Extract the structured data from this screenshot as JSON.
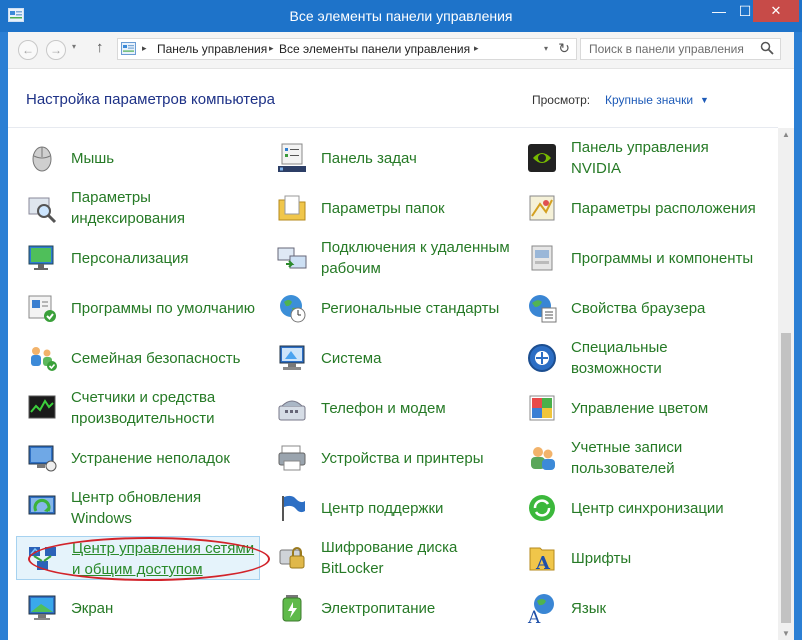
{
  "window": {
    "title": "Все элементы панели управления",
    "min_label": "—",
    "max_label": "☐",
    "close_label": "✕"
  },
  "nav": {
    "back": "←",
    "forward": "→",
    "recent": "▾",
    "up": "↑",
    "breadcrumb": [
      "Панель управления",
      "Все элементы панели управления"
    ],
    "separator": "▸",
    "address_dropdown": "▾",
    "refresh": "↻",
    "search_placeholder": "Поиск в панели управления"
  },
  "header": {
    "title": "Настройка параметров компьютера",
    "view_label": "Просмотр:",
    "view_value": "Крупные значки",
    "view_arrow": "▼"
  },
  "items": [
    {
      "label": "Мышь",
      "icon": "mouse-icon"
    },
    {
      "label": "Панель задач",
      "icon": "taskbar-icon"
    },
    {
      "label": "Панель управления NVIDIA",
      "icon": "nvidia-icon"
    },
    {
      "label": "Параметры индексирования",
      "icon": "indexing-icon"
    },
    {
      "label": "Параметры папок",
      "icon": "folder-options-icon"
    },
    {
      "label": "Параметры расположения",
      "icon": "location-icon"
    },
    {
      "label": "Персонализация",
      "icon": "personalization-icon"
    },
    {
      "label": "Подключения к удаленным рабочим",
      "icon": "remote-desktop-icon"
    },
    {
      "label": "Программы и компоненты",
      "icon": "programs-icon"
    },
    {
      "label": "Программы по умолчанию",
      "icon": "default-programs-icon"
    },
    {
      "label": "Региональные стандарты",
      "icon": "region-icon"
    },
    {
      "label": "Свойства браузера",
      "icon": "internet-options-icon"
    },
    {
      "label": "Семейная безопасность",
      "icon": "family-safety-icon"
    },
    {
      "label": "Система",
      "icon": "system-icon"
    },
    {
      "label": "Специальные возможности",
      "icon": "ease-of-access-icon"
    },
    {
      "label": "Счетчики и средства производительности",
      "icon": "performance-icon"
    },
    {
      "label": "Телефон и модем",
      "icon": "phone-modem-icon"
    },
    {
      "label": "Управление цветом",
      "icon": "color-management-icon"
    },
    {
      "label": "Устранение неполадок",
      "icon": "troubleshooting-icon"
    },
    {
      "label": "Устройства и принтеры",
      "icon": "devices-printers-icon"
    },
    {
      "label": "Учетные записи пользователей",
      "icon": "user-accounts-icon"
    },
    {
      "label": "Центр обновления Windows",
      "icon": "windows-update-icon"
    },
    {
      "label": "Центр поддержки",
      "icon": "action-center-icon"
    },
    {
      "label": "Центр синхронизации",
      "icon": "sync-center-icon"
    },
    {
      "label": "Центр управления сетями и общим доступом",
      "icon": "network-sharing-icon",
      "selected": true
    },
    {
      "label": "Шифрование диска BitLocker",
      "icon": "bitlocker-icon"
    },
    {
      "label": "Шрифты",
      "icon": "fonts-icon"
    },
    {
      "label": "Экран",
      "icon": "display-icon"
    },
    {
      "label": "Электропитание",
      "icon": "power-options-icon"
    },
    {
      "label": "Язык",
      "icon": "language-icon"
    }
  ],
  "colors": {
    "link_green": "#267a26",
    "header_blue": "#1e3287",
    "title_bar": "#1e73c9",
    "close_red": "#c74b48",
    "highlight_red": "#d2232a"
  }
}
